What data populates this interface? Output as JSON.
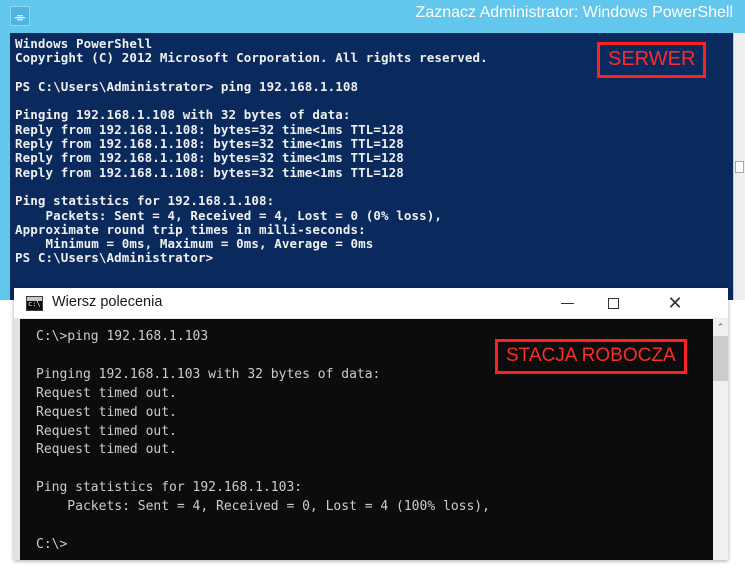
{
  "powershell": {
    "title": "Zaznacz Administrator: Windows PowerShell",
    "icon_glyph": "⌯",
    "console_text": "Windows PowerShell\nCopyright (C) 2012 Microsoft Corporation. All rights reserved.\n\nPS C:\\Users\\Administrator> ping 192.168.1.108\n\nPinging 192.168.1.108 with 32 bytes of data:\nReply from 192.168.1.108: bytes=32 time<1ms TTL=128\nReply from 192.168.1.108: bytes=32 time<1ms TTL=128\nReply from 192.168.1.108: bytes=32 time<1ms TTL=128\nReply from 192.168.1.108: bytes=32 time<1ms TTL=128\n\nPing statistics for 192.168.1.108:\n    Packets: Sent = 4, Received = 4, Lost = 0 (0% loss),\nApproximate round trip times in milli-seconds:\n    Minimum = 0ms, Maximum = 0ms, Average = 0ms\nPS C:\\Users\\Administrator>",
    "annotation": "SERWER",
    "accent_color": "#63c6ec",
    "background_color": "#0a2a5e"
  },
  "cmd": {
    "title": "Wiersz polecenia",
    "icon_text": "c:\\",
    "minimize_label": "─",
    "maximize_label": "□",
    "close_label": "✕",
    "scroll_up_label": "⌃",
    "console_text": "C:\\>ping 192.168.1.103\n\nPinging 192.168.1.103 with 32 bytes of data:\nRequest timed out.\nRequest timed out.\nRequest timed out.\nRequest timed out.\n\nPing statistics for 192.168.1.103:\n    Packets: Sent = 4, Received = 0, Lost = 4 (100% loss),\n\nC:\\>",
    "annotation": "STACJA ROBOCZA",
    "background_color": "#0c0c0c"
  },
  "annotation_color": "#ff2020"
}
